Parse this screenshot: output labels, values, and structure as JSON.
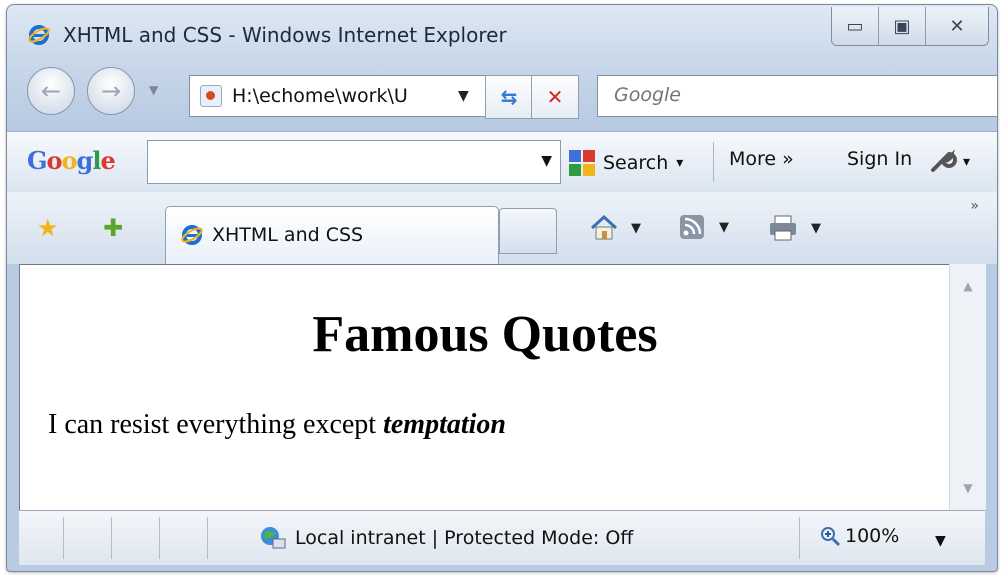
{
  "window": {
    "title": "XHTML and CSS - Windows Internet Explorer",
    "minimize_glyph": "▭",
    "maximize_glyph": "▣",
    "close_glyph": "✕"
  },
  "navbar": {
    "back_glyph": "←",
    "forward_glyph": "→",
    "history_dd": "▼",
    "address": "H:\\echome\\work\\U",
    "address_dd": "▼",
    "refresh_glyph": "⇆",
    "stop_glyph": "✕",
    "search_placeholder": "Google"
  },
  "googlebar": {
    "logo_letters": [
      "G",
      "o",
      "o",
      "g",
      "l",
      "e"
    ],
    "logo_colors": [
      "#3f6fd8",
      "#d93a2b",
      "#f2b418",
      "#3f6fd8",
      "#2f9c44",
      "#d93a2b"
    ],
    "input_dd": "▼",
    "search_label": "Search",
    "search_dd": "▾",
    "more_label": "More »",
    "signin_label": "Sign In",
    "settings_dd": "▾"
  },
  "tabs": {
    "favorites_glyph": "★",
    "add_favorite_glyph": "✚",
    "active_tab_label": "XHTML and CSS",
    "home_dd": "▼",
    "feeds_dd": "▼",
    "print_dd": "▼",
    "chevron": "»"
  },
  "page": {
    "heading": "Famous Quotes",
    "quote_prefix": "I can resist everything except ",
    "quote_emphasis": "temptation"
  },
  "scrollbar": {
    "up_glyph": "▲",
    "down_glyph": "▼"
  },
  "statusbar": {
    "zone_text": "Local intranet | Protected Mode: Off",
    "zoom_text": "100%",
    "zoom_dd": "▼"
  },
  "colors": {
    "ie_blue": "#1e6fd0",
    "stop_red": "#d4281c",
    "refresh_blue": "#2d7ad6"
  }
}
